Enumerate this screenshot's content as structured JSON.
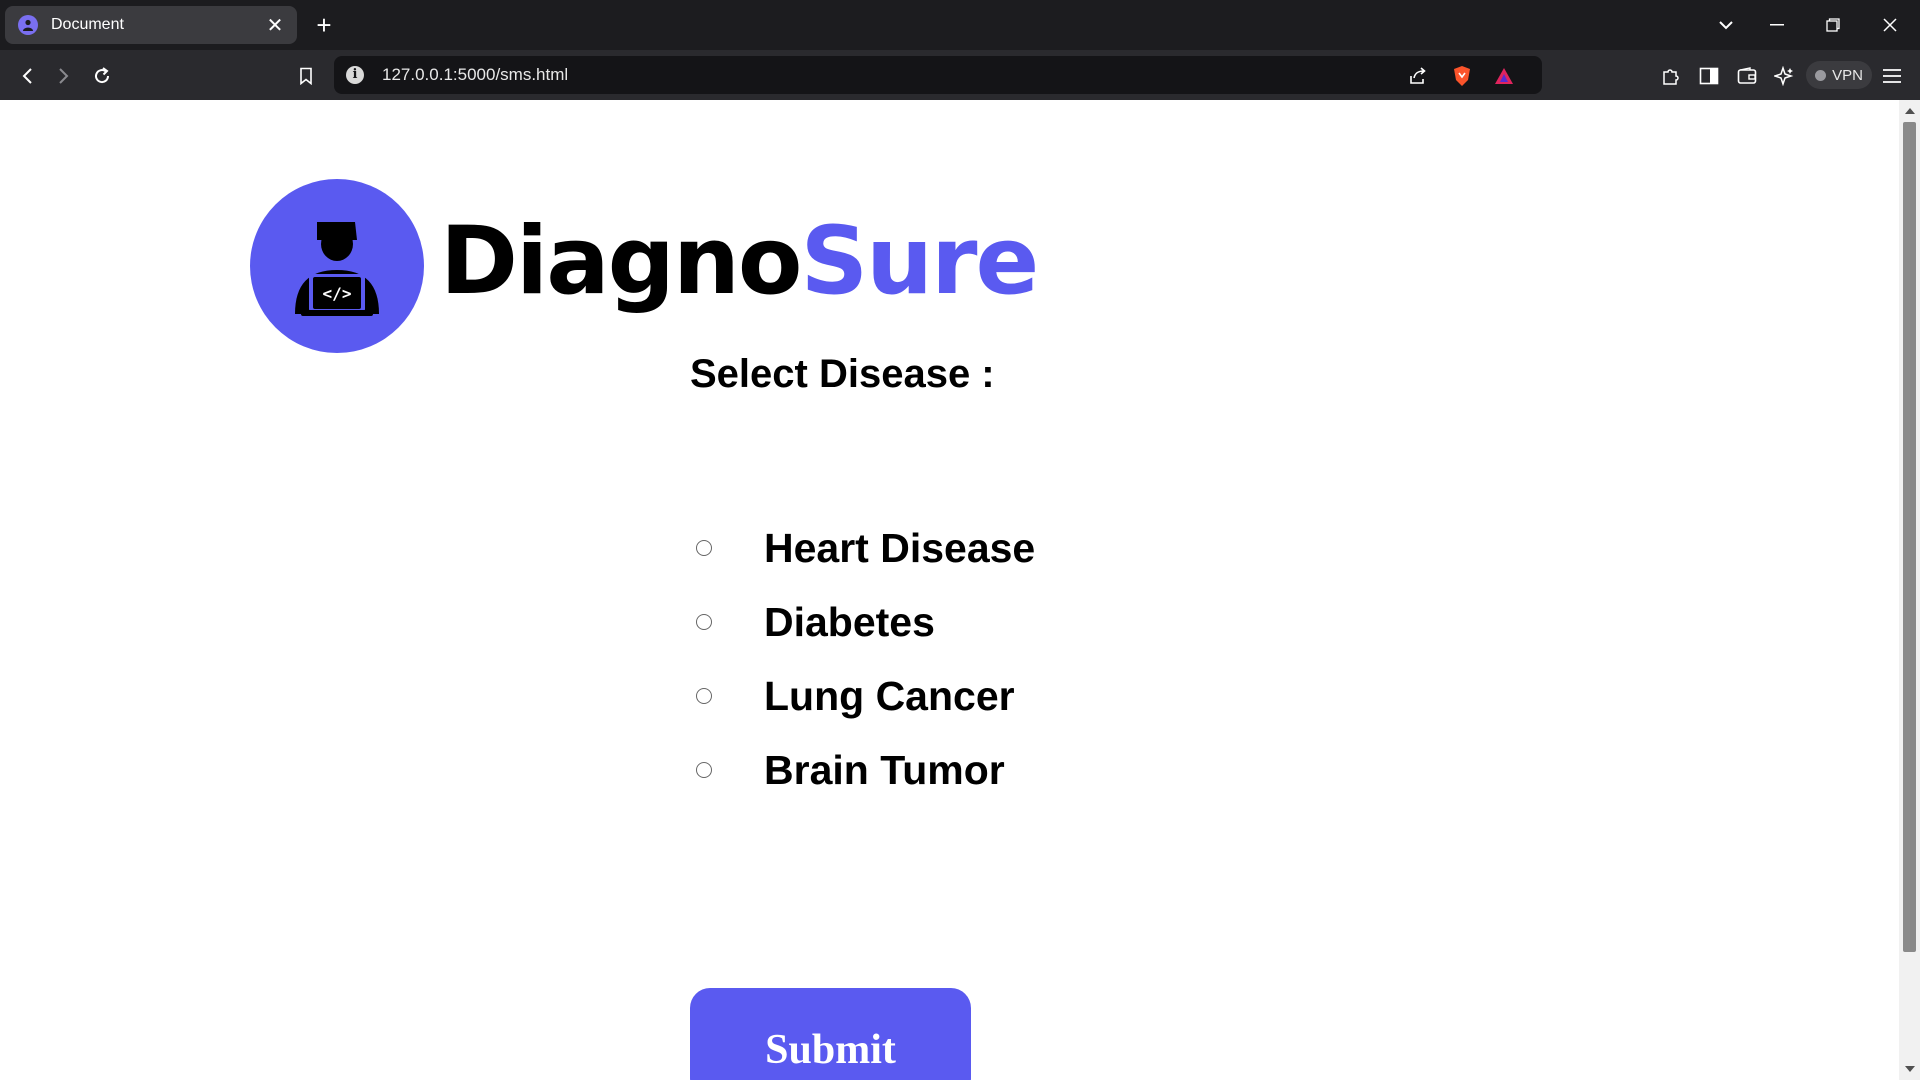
{
  "browser": {
    "tab_title": "Document",
    "tab_close": "✕",
    "new_tab": "+",
    "url": "127.0.0.1:5000/sms.html",
    "info_glyph": "i",
    "vpn_label": "VPN",
    "icons": [
      "back-icon",
      "forward-icon",
      "reload-icon",
      "bookmark-icon",
      "share-icon",
      "brave-shield-icon",
      "brave-rewards-icon",
      "extensions-icon",
      "sidebar-icon",
      "wallet-icon",
      "leo-ai-icon",
      "menu-icon"
    ]
  },
  "brand": {
    "part1": "Diagno",
    "part2": "Sure",
    "accent_color": "#5a5af0"
  },
  "form": {
    "title": "Select Disease :",
    "options": [
      {
        "label": "Heart Disease",
        "checked": false
      },
      {
        "label": "Diabetes",
        "checked": false
      },
      {
        "label": "Lung Cancer",
        "checked": false
      },
      {
        "label": "Brain Tumor",
        "checked": false
      }
    ],
    "submit_label": "Submit"
  }
}
